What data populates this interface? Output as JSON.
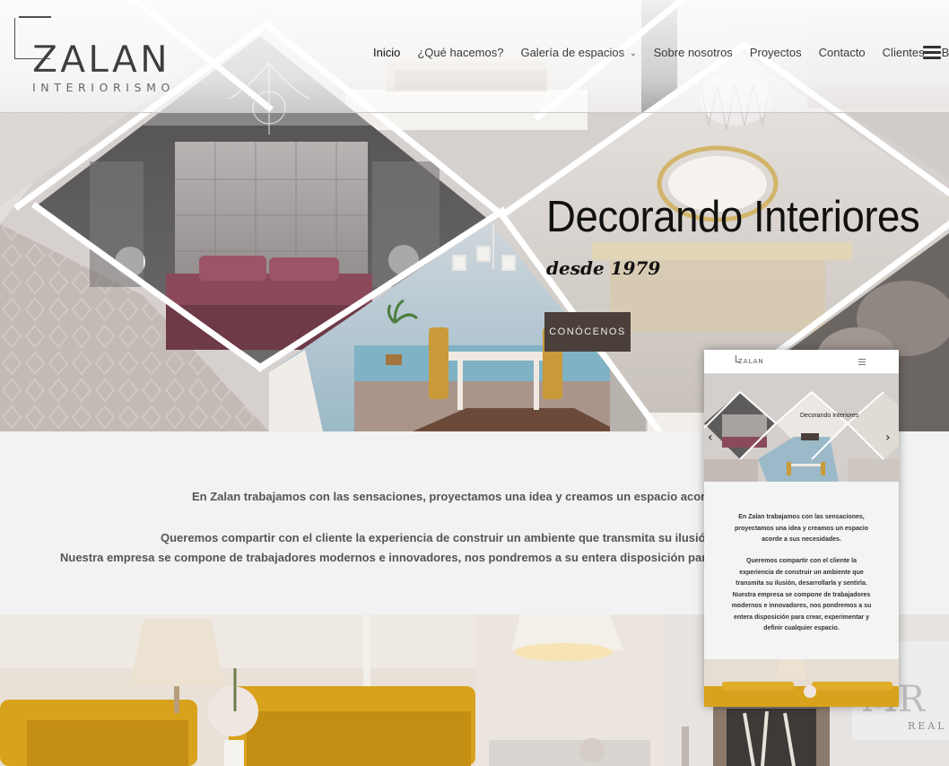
{
  "brand": {
    "name": "ZALAN",
    "tagline": "INTERIORISMO"
  },
  "nav": {
    "items": [
      {
        "label": "Inicio",
        "active": true
      },
      {
        "label": "¿Qué hacemos?"
      },
      {
        "label": "Galería de espacios",
        "has_dropdown": true
      },
      {
        "label": "Sobre nosotros"
      },
      {
        "label": "Proyectos"
      },
      {
        "label": "Contacto"
      },
      {
        "label": "Clientes"
      },
      {
        "label": "Blog"
      }
    ],
    "dropdown_icon": "chevron-down-icon",
    "menu_icon": "hamburger-menu-icon"
  },
  "hero": {
    "title": "Decorando Interiores",
    "subtitle": "desde 1979",
    "cta_label": "CONÓCENOS"
  },
  "intro": {
    "line1": "En Zalan trabajamos con las sensaciones, proyectamos una idea y creamos un espacio acorde a sus nec",
    "line2": "Queremos compartir con el cliente la experiencia de construir un ambiente que transmita su ilusión, desarro",
    "line3": "Nuestra empresa se compone de trabajadores modernos e innovadores, nos pondremos a su entera disposición para crear, exper"
  },
  "phone": {
    "logo": "ZALAN",
    "hero_title": "Decorando Interiores",
    "prev_icon": "chevron-left-icon",
    "next_icon": "chevron-right-icon",
    "para1": [
      "En Zalan trabajamos con las sensaciones,",
      "proyectamos una idea y creamos un espacio",
      "acorde a sus necesidades."
    ],
    "para2": [
      "Queremos compartir con el cliente la",
      "experiencia de construir un ambiente que",
      "transmita su ilusión, desarrollarla y sentirla.",
      "Nuestra empresa se compone de trabajadores",
      "modernos e innovadores, nos pondremos a su",
      "entera disposición para crear, experimentar y",
      "definir cualquier espacio."
    ]
  },
  "gallery": {
    "sign_text": "MR",
    "sign_sub": "REAL"
  },
  "colors": {
    "accent_button": "#4a3f3b",
    "text_dark": "#111111",
    "body_text": "#555555",
    "background": "#f2f2f2",
    "sofa_yellow": "#d9a21c"
  }
}
